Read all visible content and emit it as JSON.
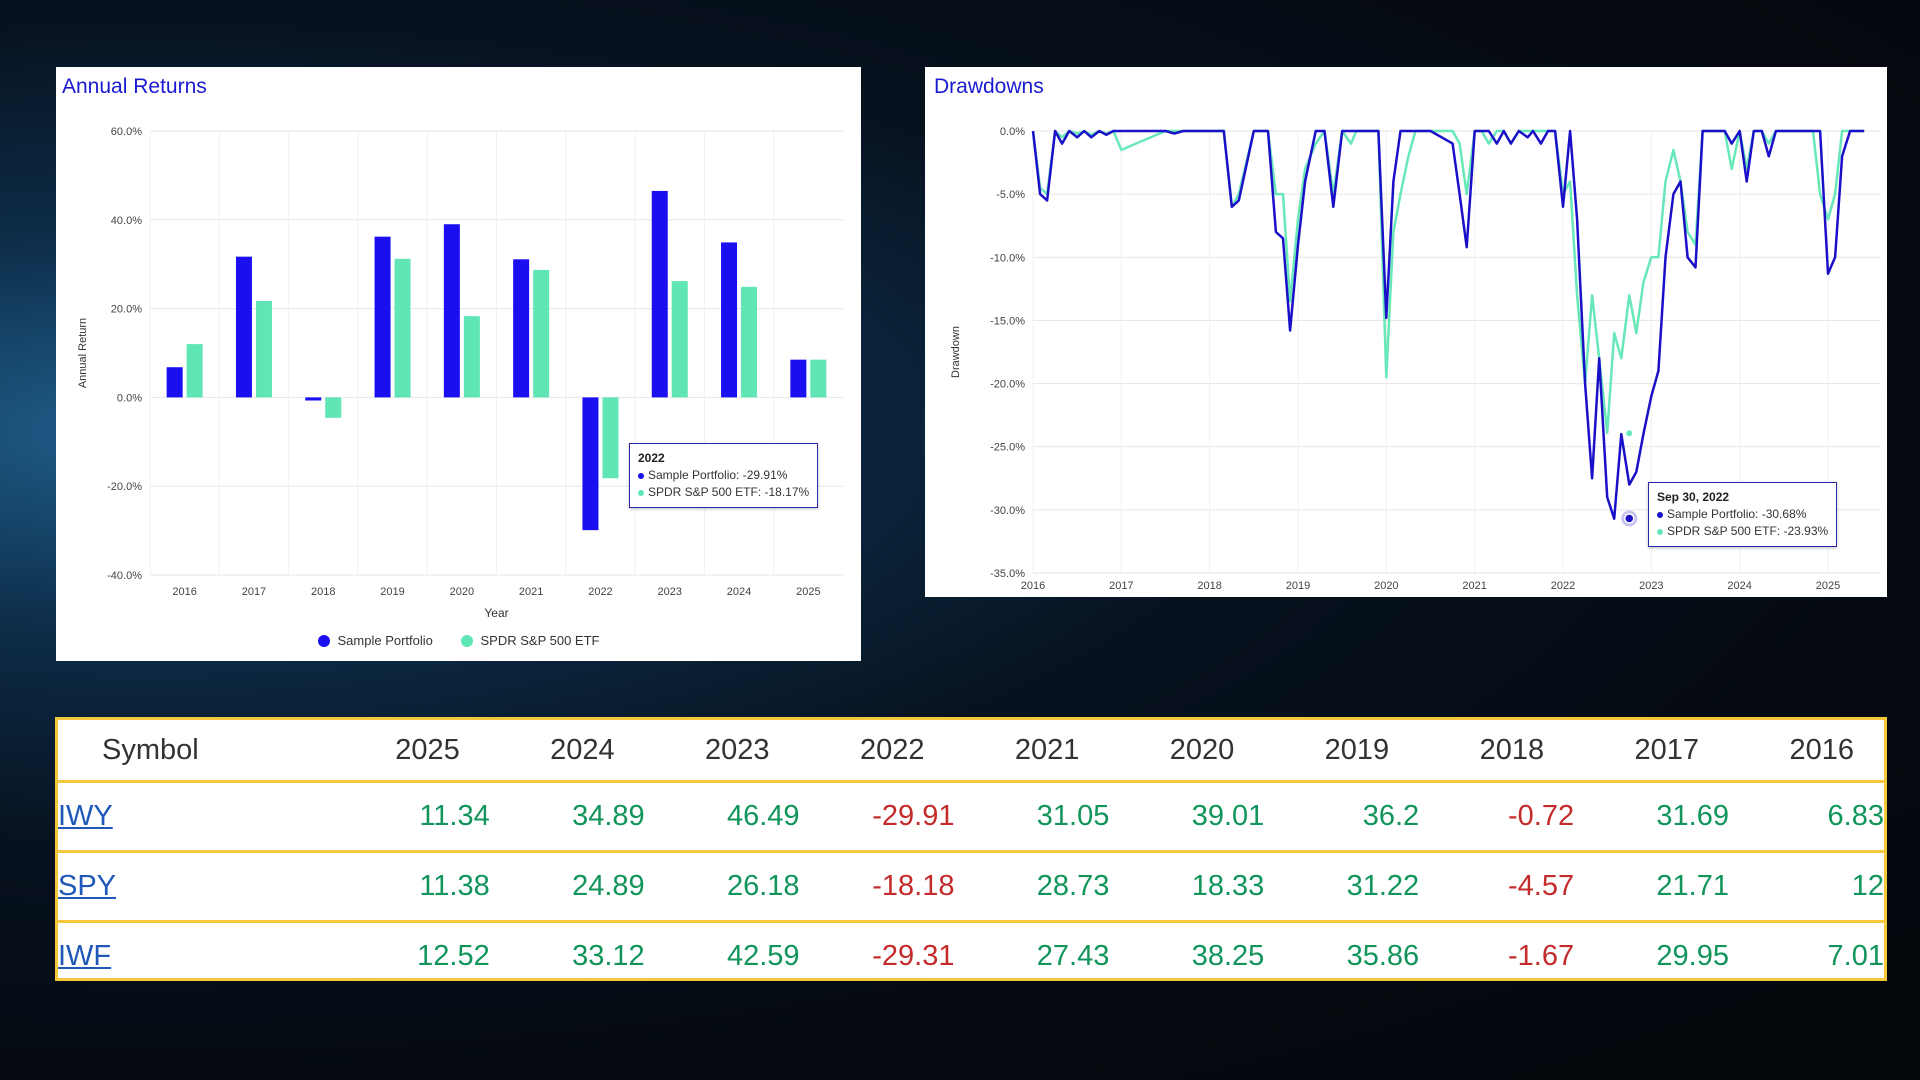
{
  "returns_panel": {
    "title": "Annual Returns",
    "tooltip": {
      "title": "2022",
      "line1": "Sample Portfolio: -29.91%",
      "line2": "SPDR S&P 500 ETF: -18.17%"
    },
    "legend": [
      "Sample Portfolio",
      "SPDR S&P 500 ETF"
    ]
  },
  "drawdowns_panel": {
    "title": "Drawdowns",
    "tooltip": {
      "title": "Sep 30, 2022",
      "line1": "Sample Portfolio: -30.68%",
      "line2": "SPDR S&P 500 ETF: -23.93%"
    }
  },
  "colors": {
    "portfolio": "#1a0ff0",
    "etf": "#5fe6b4",
    "dd_portfolio": "#1a10c8",
    "dd_etf": "#68e8b8"
  },
  "chart_data": [
    {
      "type": "bar",
      "title": "Annual Returns",
      "xlabel": "Year",
      "ylabel": "Annual Return",
      "ylim": [
        -40,
        60
      ],
      "yticks": [
        "60.0%",
        "40.0%",
        "20.0%",
        "0.0%",
        "-20.0%",
        "-40.0%"
      ],
      "categories": [
        "2016",
        "2017",
        "2018",
        "2019",
        "2020",
        "2021",
        "2022",
        "2023",
        "2024",
        "2025"
      ],
      "series": [
        {
          "name": "Sample Portfolio",
          "values": [
            6.8,
            31.7,
            -0.7,
            36.2,
            39.0,
            31.1,
            -29.9,
            46.5,
            34.9,
            8.5
          ]
        },
        {
          "name": "SPDR S&P 500 ETF",
          "values": [
            12.0,
            21.7,
            -4.6,
            31.2,
            18.3,
            28.7,
            -18.2,
            26.2,
            24.9,
            8.5
          ]
        }
      ],
      "grid": true,
      "legend_position": "bottom"
    },
    {
      "type": "line",
      "title": "Drawdowns",
      "ylabel": "Drawdown",
      "ylim": [
        -35,
        0
      ],
      "yticks": [
        "0.0%",
        "-5.0%",
        "-10.0%",
        "-15.0%",
        "-20.0%",
        "-25.0%",
        "-30.0%",
        "-35.0%"
      ],
      "xticks": [
        "2016",
        "2017",
        "2018",
        "2019",
        "2020",
        "2021",
        "2022",
        "2023",
        "2024",
        "2025"
      ],
      "grid": true,
      "series": [
        {
          "name": "Sample Portfolio",
          "x": [
            2016.0,
            2016.08,
            2016.16,
            2016.25,
            2016.33,
            2016.41,
            2016.5,
            2016.58,
            2016.66,
            2016.75,
            2016.83,
            2016.91,
            2017.0,
            2017.5,
            2017.6,
            2017.7,
            2018.0,
            2018.08,
            2018.16,
            2018.25,
            2018.33,
            2018.5,
            2018.66,
            2018.75,
            2018.83,
            2018.91,
            2019.0,
            2019.08,
            2019.2,
            2019.3,
            2019.4,
            2019.5,
            2019.6,
            2019.66,
            2019.75,
            2019.83,
            2019.91,
            2020.0,
            2020.08,
            2020.16,
            2020.25,
            2020.33,
            2020.5,
            2020.75,
            2020.83,
            2020.91,
            2021.0,
            2021.08,
            2021.16,
            2021.25,
            2021.33,
            2021.41,
            2021.5,
            2021.6,
            2021.66,
            2021.75,
            2021.83,
            2021.91,
            2022.0,
            2022.08,
            2022.16,
            2022.25,
            2022.33,
            2022.41,
            2022.5,
            2022.58,
            2022.66,
            2022.75,
            2022.83,
            2022.91,
            2023.0,
            2023.08,
            2023.16,
            2023.25,
            2023.33,
            2023.41,
            2023.5,
            2023.58,
            2023.66,
            2023.75,
            2023.83,
            2023.91,
            2024.0,
            2024.08,
            2024.16,
            2024.25,
            2024.33,
            2024.41,
            2024.5,
            2024.58,
            2024.66,
            2024.75,
            2024.83,
            2024.91,
            2025.0,
            2025.08,
            2025.16,
            2025.25,
            2025.33,
            2025.41
          ],
          "y": [
            0,
            -5,
            -5.5,
            0,
            -1,
            0,
            -0.5,
            0,
            -0.5,
            0,
            -0.3,
            0,
            0,
            0,
            -0.2,
            0,
            0,
            0,
            0,
            -6,
            -5.5,
            0,
            0,
            -8,
            -8.5,
            -15.8,
            -9,
            -4,
            0,
            0,
            -6,
            0,
            0,
            0,
            0,
            0,
            0,
            -14.8,
            -4,
            0,
            0,
            0,
            0,
            -1,
            -5,
            -9.2,
            0,
            0,
            0,
            -1,
            0,
            -1,
            0,
            -0.5,
            0,
            -1,
            0,
            0,
            -6,
            0,
            -7,
            -20,
            -27.5,
            -18,
            -29,
            -30.7,
            -24,
            -28,
            -27,
            -24,
            -21,
            -19,
            -10,
            -5,
            -4,
            -10,
            -10.8,
            0,
            0,
            0,
            0,
            -1,
            0,
            -4,
            0,
            0,
            -2,
            0,
            0,
            0,
            0,
            0,
            0,
            0,
            -11.3,
            -10,
            -2,
            0,
            0,
            0
          ],
          "y_comment": "values in percent"
        },
        {
          "name": "SPDR S&P 500 ETF",
          "x": [
            2016.0,
            2016.08,
            2016.16,
            2016.25,
            2016.33,
            2016.41,
            2016.5,
            2016.58,
            2016.66,
            2016.75,
            2016.83,
            2016.91,
            2017.0,
            2017.5,
            2017.6,
            2017.7,
            2018.0,
            2018.08,
            2018.16,
            2018.25,
            2018.33,
            2018.5,
            2018.66,
            2018.75,
            2018.83,
            2018.91,
            2019.0,
            2019.08,
            2019.2,
            2019.3,
            2019.4,
            2019.5,
            2019.6,
            2019.66,
            2019.75,
            2019.83,
            2019.91,
            2020.0,
            2020.08,
            2020.16,
            2020.25,
            2020.33,
            2020.5,
            2020.75,
            2020.83,
            2020.91,
            2021.0,
            2021.08,
            2021.16,
            2021.25,
            2021.33,
            2021.41,
            2021.5,
            2021.6,
            2021.66,
            2021.75,
            2021.83,
            2021.91,
            2022.0,
            2022.08,
            2022.16,
            2022.25,
            2022.33,
            2022.41,
            2022.5,
            2022.58,
            2022.66,
            2022.75,
            2022.83,
            2022.91,
            2023.0,
            2023.08,
            2023.16,
            2023.25,
            2023.33,
            2023.41,
            2023.5,
            2023.58,
            2023.66,
            2023.75,
            2023.83,
            2023.91,
            2024.0,
            2024.08,
            2024.16,
            2024.25,
            2024.33,
            2024.41,
            2024.5,
            2024.58,
            2024.66,
            2024.75,
            2024.83,
            2024.91,
            2025.0,
            2025.08,
            2025.16,
            2025.25,
            2025.33,
            2025.41
          ],
          "y": [
            0,
            -4.5,
            -5,
            0,
            -0.5,
            0,
            -0.2,
            0,
            -0.3,
            0,
            -0.2,
            0,
            -1.5,
            0,
            0,
            0,
            0,
            0,
            0,
            -6,
            -5,
            0,
            0,
            -5,
            -5,
            -13.5,
            -7,
            -3,
            -1,
            0,
            -5,
            0,
            -1,
            0,
            0,
            0,
            0,
            -19.5,
            -8,
            -5,
            -2,
            0,
            0,
            0,
            -1,
            -5,
            0,
            0,
            -1,
            0,
            0,
            -1,
            0,
            0,
            0,
            0,
            0,
            0,
            -5,
            -4,
            -13,
            -20,
            -13,
            -18,
            -23.9,
            -16,
            -18,
            -13,
            -16,
            -12,
            -10,
            -10,
            -4,
            -1.5,
            -4,
            -8,
            -9,
            0,
            0,
            0,
            0,
            -3,
            0,
            -3,
            0,
            0,
            -1,
            0,
            0,
            0,
            0,
            0,
            0,
            -5,
            -7,
            -5,
            0,
            0,
            0,
            0
          ]
        }
      ]
    },
    {
      "type": "table",
      "columns": [
        "Symbol",
        "2025",
        "2024",
        "2023",
        "2022",
        "2021",
        "2020",
        "2019",
        "2018",
        "2017",
        "2016"
      ],
      "rows": [
        [
          "IWY",
          "11.34",
          "34.89",
          "46.49",
          "-29.91",
          "31.05",
          "39.01",
          "36.2",
          "-0.72",
          "31.69",
          "6.83"
        ],
        [
          "SPY",
          "11.38",
          "24.89",
          "26.18",
          "-18.18",
          "28.73",
          "18.33",
          "31.22",
          "-4.57",
          "21.71",
          "12"
        ],
        [
          "IWF",
          "12.52",
          "33.12",
          "42.59",
          "-29.31",
          "27.43",
          "38.25",
          "35.86",
          "-1.67",
          "29.95",
          "7.01"
        ]
      ]
    }
  ]
}
